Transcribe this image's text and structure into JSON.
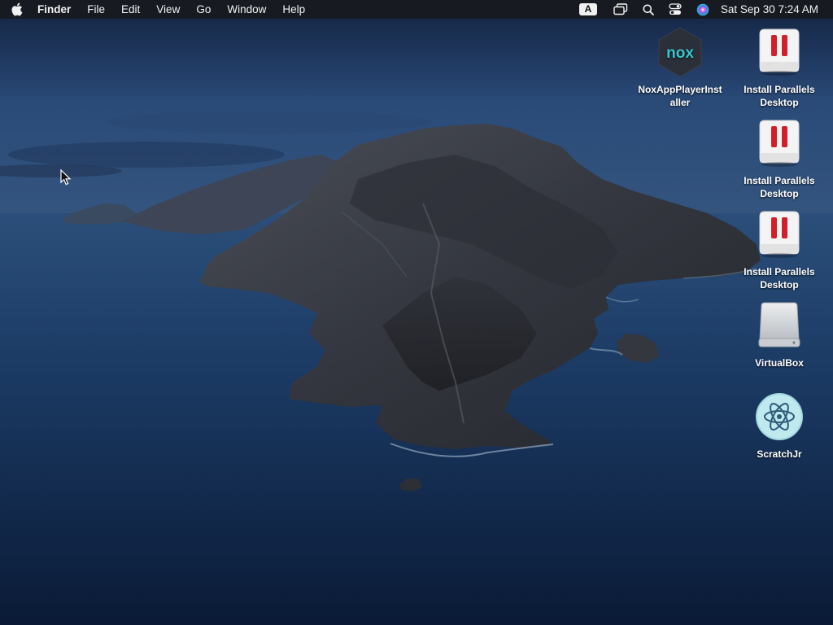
{
  "menubar": {
    "app_name": "Finder",
    "items": [
      {
        "label": "File"
      },
      {
        "label": "Edit"
      },
      {
        "label": "View"
      },
      {
        "label": "Go"
      },
      {
        "label": "Window"
      },
      {
        "label": "Help"
      }
    ],
    "status": {
      "input_source": "A",
      "icons": [
        "screen-mirroring-icon",
        "spotlight-search-icon",
        "control-center-icon",
        "siri-icon"
      ],
      "clock": "Sat Sep 30  7:24 AM"
    }
  },
  "desktop_icons": [
    {
      "label": "NoxAppPlayerInstaller",
      "display": "NoxAppPlayerInst\naller",
      "icon": "nox-installer-icon"
    },
    {
      "label": "Install Parallels Desktop",
      "icon": "parallels-installer-icon"
    },
    {
      "label": "Install Parallels Desktop",
      "icon": "parallels-installer-icon"
    },
    {
      "label": "Install Parallels Desktop",
      "icon": "parallels-installer-icon"
    },
    {
      "label": "VirtualBox",
      "icon": "disk-volume-icon"
    },
    {
      "label": "ScratchJr",
      "icon": "scratchjr-app-icon"
    }
  ],
  "nox_logo_text": "nox",
  "colors": {
    "menubar_bg": "#181a1e",
    "parallels_red": "#d0202a",
    "nox_teal": "#39c6cf",
    "scratchjr_bg": "#bfe9ee"
  }
}
